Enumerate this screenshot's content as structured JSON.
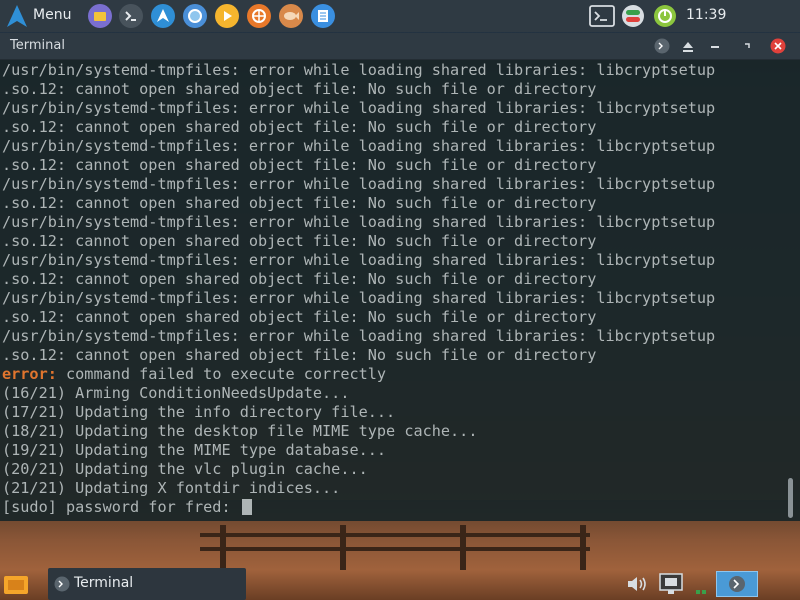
{
  "top_panel": {
    "menu_label": "Menu",
    "launchers": [
      "files-icon",
      "terminal-icon",
      "arch-icon",
      "chromium-icon",
      "media-player-icon",
      "orange-app-icon",
      "fish-app-icon",
      "text-editor-icon"
    ],
    "clock": "11:39"
  },
  "window": {
    "title": "Terminal",
    "lines": [
      {
        "text": "/usr/bin/systemd-tmpfiles: error while loading shared libraries: libcryptsetup"
      },
      {
        "text": ".so.12: cannot open shared object file: No such file or directory"
      },
      {
        "text": "/usr/bin/systemd-tmpfiles: error while loading shared libraries: libcryptsetup"
      },
      {
        "text": ".so.12: cannot open shared object file: No such file or directory"
      },
      {
        "text": "/usr/bin/systemd-tmpfiles: error while loading shared libraries: libcryptsetup"
      },
      {
        "text": ".so.12: cannot open shared object file: No such file or directory"
      },
      {
        "text": "/usr/bin/systemd-tmpfiles: error while loading shared libraries: libcryptsetup"
      },
      {
        "text": ".so.12: cannot open shared object file: No such file or directory"
      },
      {
        "text": "/usr/bin/systemd-tmpfiles: error while loading shared libraries: libcryptsetup"
      },
      {
        "text": ".so.12: cannot open shared object file: No such file or directory"
      },
      {
        "text": "/usr/bin/systemd-tmpfiles: error while loading shared libraries: libcryptsetup"
      },
      {
        "text": ".so.12: cannot open shared object file: No such file or directory"
      },
      {
        "text": "/usr/bin/systemd-tmpfiles: error while loading shared libraries: libcryptsetup"
      },
      {
        "text": ".so.12: cannot open shared object file: No such file or directory"
      },
      {
        "text": "/usr/bin/systemd-tmpfiles: error while loading shared libraries: libcryptsetup"
      },
      {
        "text": ".so.12: cannot open shared object file: No such file or directory"
      },
      {
        "prefix": "error:",
        "text": " command failed to execute correctly"
      },
      {
        "text": "(16/21) Arming ConditionNeedsUpdate..."
      },
      {
        "text": "(17/21) Updating the info directory file..."
      },
      {
        "text": "(18/21) Updating the desktop file MIME type cache..."
      },
      {
        "text": "(19/21) Updating the MIME type database..."
      },
      {
        "text": "(20/21) Updating the vlc plugin cache..."
      },
      {
        "text": "(21/21) Updating X fontdir indices..."
      },
      {
        "text": "[sudo] password for fred: ",
        "cursor": true
      }
    ],
    "colors": {
      "error": "#e0752e",
      "text": "#aeb5b6",
      "close": "#e0413b"
    }
  },
  "bottom_panel": {
    "task_label": "Terminal"
  }
}
